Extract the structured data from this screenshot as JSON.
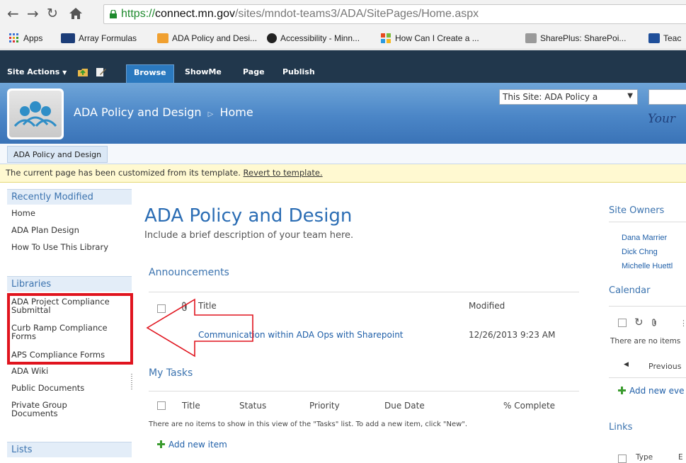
{
  "browser": {
    "url_scheme": "https://",
    "url_host": "connect.mn.gov",
    "url_path": "/sites/mndot-teams3/ADA/SitePages/Home.aspx",
    "nav_icons": [
      "back-arrow-icon",
      "forward-arrow-icon",
      "reload-icon",
      "home-icon"
    ],
    "bookmarks": [
      {
        "label": "Apps",
        "icon": "apps-grid-icon",
        "color": "#3b73d6"
      },
      {
        "label": "Array Formulas",
        "icon": "site-favicon",
        "color": "#1c3d78"
      },
      {
        "label": "ADA Policy and Desi...",
        "icon": "sharepoint-favicon",
        "color": "#f0a030"
      },
      {
        "label": "Accessibility - Minn...",
        "icon": "accessibility-favicon",
        "color": "#222222"
      },
      {
        "label": "How Can I Create a ...",
        "icon": "windows-favicon",
        "color": "#e84b1f"
      },
      {
        "label": "SharePlus: SharePoi...",
        "icon": "shareplus-favicon",
        "color": "#9a9a9a"
      },
      {
        "label": "Teac",
        "icon": "teac-favicon",
        "color": "#1f4f9a"
      }
    ]
  },
  "ribbon": {
    "site_actions": "Site Actions",
    "tabs": [
      "Browse",
      "ShowMe",
      "Page",
      "Publish"
    ],
    "active_tab": "Browse"
  },
  "header": {
    "site_name": "ADA Policy and Design",
    "breadcrumb_sep": "▷",
    "page_name": "Home",
    "search_scope": "This Site: ADA Policy a",
    "cropped_text": "Your"
  },
  "topnav": {
    "item": "ADA Policy and Design"
  },
  "status": {
    "message": "The current page has been customized from its template.",
    "link": "Revert to template."
  },
  "quicklaunch": {
    "recently_modified_title": "Recently Modified",
    "recently_modified": [
      "Home",
      "ADA Plan Design",
      "How To Use This Library"
    ],
    "libraries_title": "Libraries",
    "libraries": [
      [
        "ADA Project Compliance",
        "Submittal"
      ],
      [
        "Curb Ramp Compliance",
        "Forms"
      ],
      [
        "APS Compliance Forms"
      ],
      [
        "ADA Wiki"
      ],
      [
        "Public Documents"
      ],
      [
        "Private Group",
        "Documents"
      ]
    ],
    "lists_title": "Lists"
  },
  "main": {
    "title": "ADA Policy and Design",
    "description": "Include a brief description of your team here.",
    "announcements": {
      "title": "Announcements",
      "columns": [
        "Title",
        "Modified"
      ],
      "rows": [
        {
          "title": "Communication within ADA Ops with Sharepoint",
          "modified": "12/26/2013 9:23 AM"
        }
      ]
    },
    "tasks": {
      "title": "My Tasks",
      "columns": [
        "Title",
        "Status",
        "Priority",
        "Due Date",
        "% Complete"
      ],
      "empty": "There are no items to show in this view of the \"Tasks\" list. To add a new item, click \"New\".",
      "add_new": "Add new item"
    }
  },
  "right": {
    "site_owners_title": "Site Owners",
    "owners": [
      "Dana Marrier",
      "Dick Chng",
      "Michelle Huettl"
    ],
    "calendar_title": "Calendar",
    "calendar_empty": "There are no items",
    "previous": "Previous",
    "add_new_event": "Add new eve",
    "links_title": "Links",
    "links_columns": [
      "Type",
      "E"
    ]
  },
  "colors": {
    "ribbon": "#21374c",
    "active_tab": "#2b79bf",
    "heading": "#2b6db4",
    "annotation_red": "#e0141e"
  }
}
